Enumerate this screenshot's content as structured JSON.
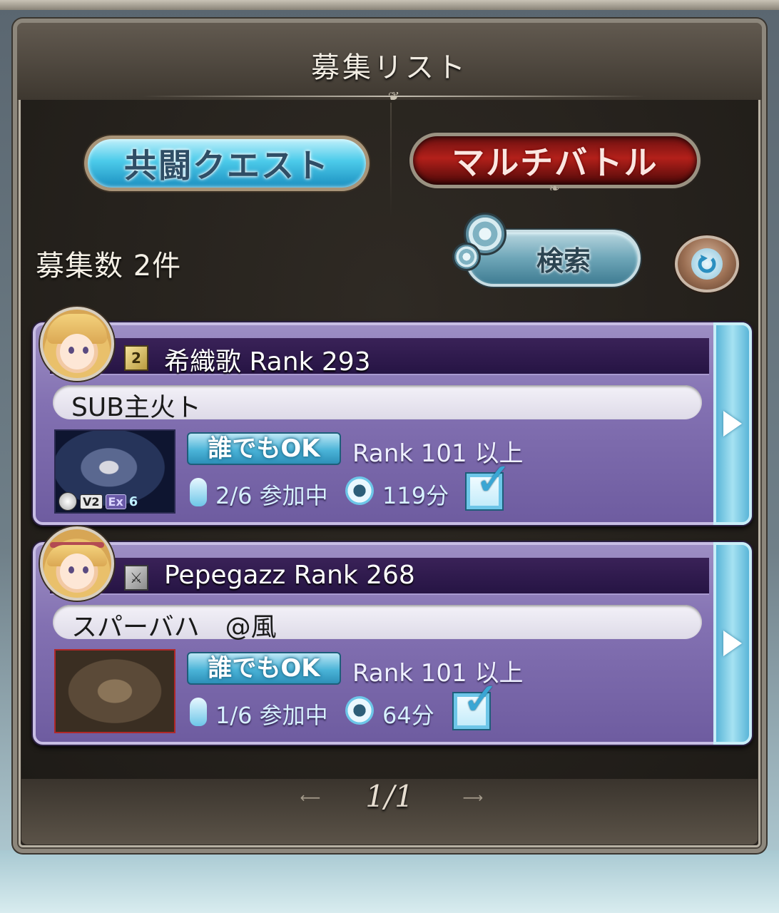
{
  "panel": {
    "title": "募集リスト"
  },
  "tabs": {
    "coop_label": "共闘クエスト",
    "multi_label": "マルチバトル"
  },
  "toolbar": {
    "recruit_count": "募集数 2件",
    "search_label": "検索"
  },
  "rooms": [
    {
      "name": "希織歌 Rank 293",
      "comment": "SUB主火ト",
      "badge": "誰でもOK",
      "rank_requirement": "Rank 101 以上",
      "members": "2/6 参加中",
      "time_remaining": "119分",
      "thumb_tags": {
        "v2": "V2",
        "ex": "Ex",
        "count": "6"
      }
    },
    {
      "name": "Pepegazz Rank 268",
      "comment": "スパーバハ　@風",
      "badge": "誰でもOK",
      "rank_requirement": "Rank 101 以上",
      "members": "1/6 参加中",
      "time_remaining": "64分"
    }
  ],
  "pager": {
    "text": "1/1"
  },
  "colors": {
    "coop_tab": "#4ccbea",
    "multi_tab": "#b3201a",
    "card_bg": "#8371b2",
    "accent_blue": "#6dc6e8"
  }
}
